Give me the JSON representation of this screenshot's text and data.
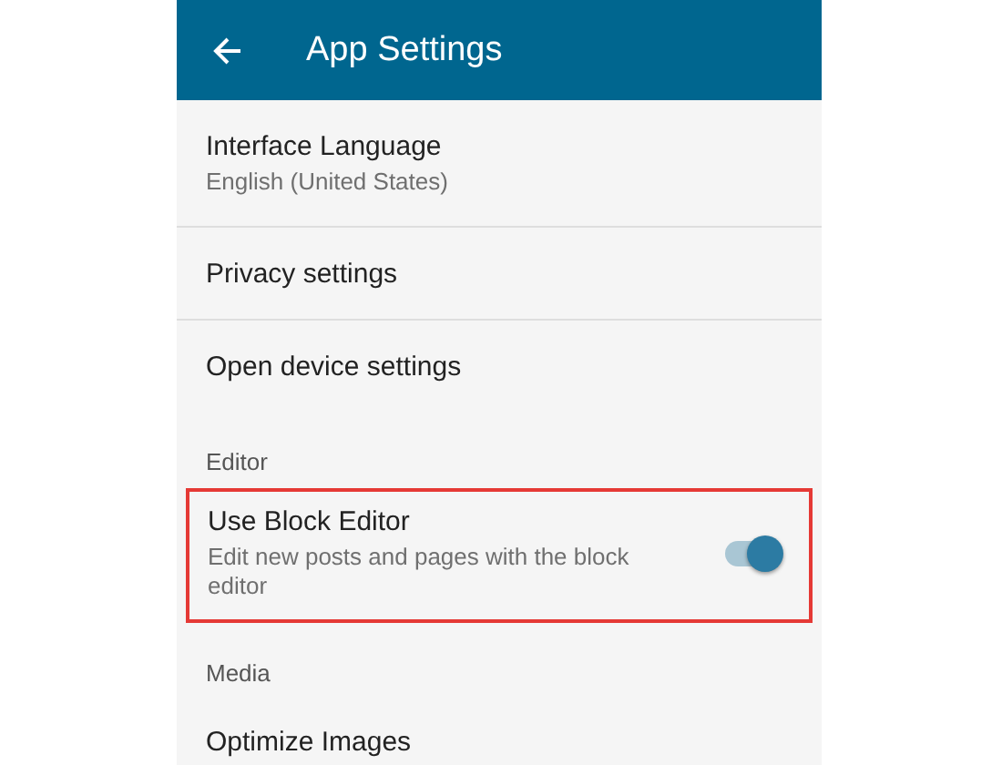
{
  "app_bar": {
    "title": "App Settings"
  },
  "items": [
    {
      "kind": "link",
      "title": "Interface Language",
      "subtitle": "English (United States)"
    },
    {
      "kind": "link",
      "title": "Privacy settings"
    },
    {
      "kind": "link",
      "title": "Open device settings"
    },
    {
      "kind": "section",
      "title": "Editor"
    },
    {
      "kind": "toggle",
      "title": "Use Block Editor",
      "subtitle": "Edit new posts and pages with the block editor",
      "on": true,
      "highlighted": true
    },
    {
      "kind": "section",
      "title": "Media"
    },
    {
      "kind": "link",
      "title": "Optimize Images"
    }
  ]
}
